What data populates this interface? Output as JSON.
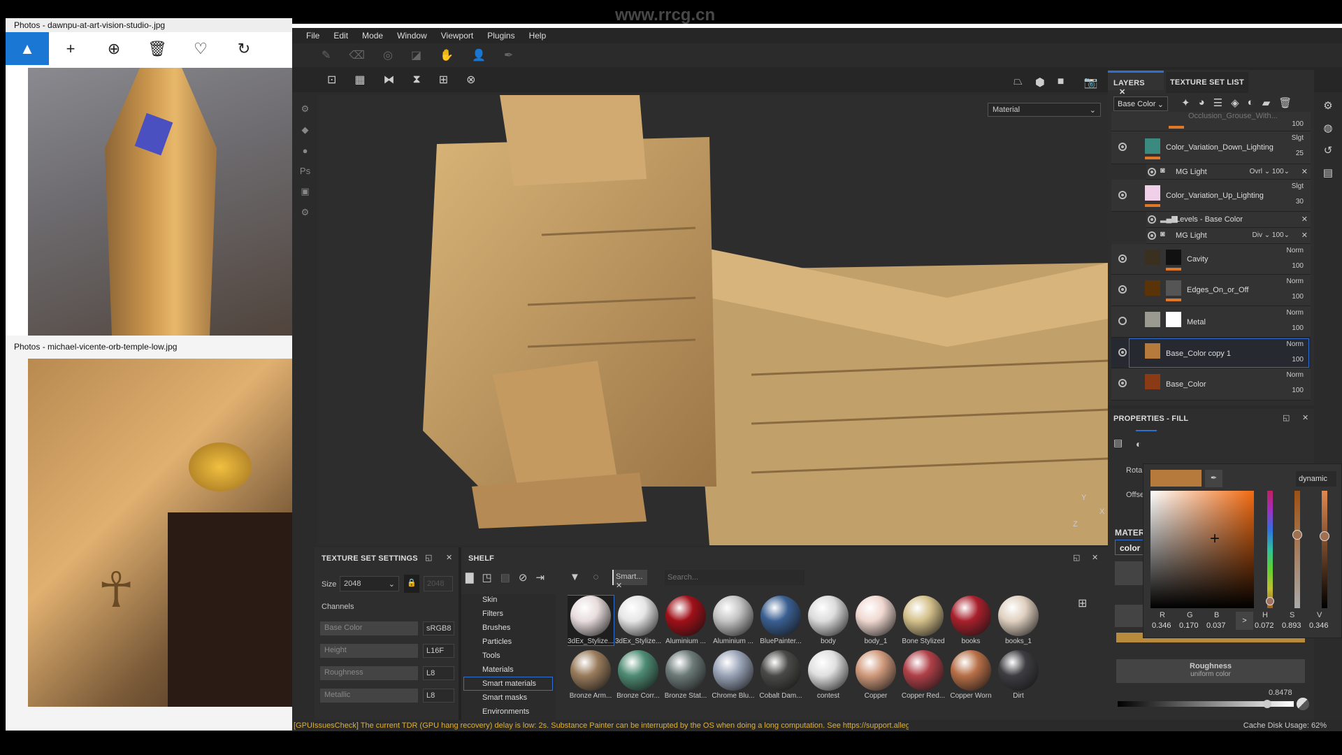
{
  "watermark": "www.rrcg.cn",
  "photos1": {
    "title": "Photos - dawnpu-at-art-vision-studio-.jpg",
    "tools": [
      "image-icon",
      "plus-icon",
      "zoom-in-icon",
      "trash-icon",
      "heart-icon",
      "rotate-icon",
      "edit-icon"
    ]
  },
  "photos2": {
    "title": "Photos - michael-vicente-orb-temple-low.jpg"
  },
  "menu": [
    "File",
    "Edit",
    "Mode",
    "Window",
    "Viewport",
    "Plugins",
    "Help"
  ],
  "viewport": {
    "mode_select": "Material",
    "axis": {
      "x": "X",
      "y": "Y",
      "z": "Z"
    }
  },
  "layers": {
    "tabs": [
      "LAYERS",
      "TEXTURE SET LIST"
    ],
    "channel": "Base Color",
    "items": [
      {
        "name": "Occlusion_Grouse_With...",
        "blend": "",
        "opacity": "100",
        "visible": true
      },
      {
        "name": "Color_Variation_Down_Lighting",
        "blend": "Slgt",
        "opacity": "25",
        "visible": true
      },
      {
        "name": "MG Light",
        "blend": "Ovrl",
        "opacity": "100",
        "sub": true
      },
      {
        "name": "Color_Variation_Up_Lighting",
        "blend": "Slgt",
        "opacity": "30",
        "visible": true
      },
      {
        "name": "Levels - Base Color",
        "blend": "",
        "opacity": "",
        "sub": true
      },
      {
        "name": "MG Light",
        "blend": "Div",
        "opacity": "100",
        "sub": true
      },
      {
        "name": "Cavity",
        "blend": "Norm",
        "opacity": "100",
        "visible": true
      },
      {
        "name": "Edges_On_or_Off",
        "blend": "Norm",
        "opacity": "100",
        "visible": true
      },
      {
        "name": "Metal",
        "blend": "Norm",
        "opacity": "100",
        "visible": false
      },
      {
        "name": "Base_Color copy 1",
        "blend": "Norm",
        "opacity": "100",
        "visible": true,
        "selected": true
      },
      {
        "name": "Base_Color",
        "blend": "Norm",
        "opacity": "100",
        "visible": true
      }
    ]
  },
  "properties": {
    "title": "PROPERTIES - FILL",
    "rotation_label": "Rota",
    "offset_label": "Offse",
    "material_label": "MATER",
    "color_tab": "color",
    "roughness": {
      "title": "Roughness",
      "subtitle": "uniform color",
      "value": "0.8478",
      "fraction": 0.8478
    }
  },
  "color_picker": {
    "mode": "dynamic",
    "swatch": "#b57a3c",
    "labels": {
      "r": "R",
      "g": "G",
      "b": "B",
      "h": "H",
      "s": "S",
      "v": "V"
    },
    "values": {
      "r": "0.346",
      "g": "0.170",
      "b": "0.037",
      "h": "0.072",
      "s": "0.893",
      "v": "0.346"
    },
    "toggle": ">"
  },
  "texture_set": {
    "title": "TEXTURE SET SETTINGS",
    "size_label": "Size",
    "size": "2048",
    "size_locked": "2048",
    "channels_label": "Channels",
    "channels": [
      {
        "name": "Base Color",
        "format": "sRGB8"
      },
      {
        "name": "Height",
        "format": "L16F"
      },
      {
        "name": "Roughness",
        "format": "L8"
      },
      {
        "name": "Metallic",
        "format": "L8"
      }
    ]
  },
  "shelf": {
    "title": "SHELF",
    "filter_chip": "Smart...",
    "search_placeholder": "Search...",
    "categories": [
      "Skin",
      "Filters",
      "Brushes",
      "Particles",
      "Tools",
      "Materials",
      "Smart materials",
      "Smart masks",
      "Environments"
    ],
    "selected_category": "Smart materials",
    "materials": [
      {
        "name": "3dEx_Stylize...",
        "color": "#e8dcdc"
      },
      {
        "name": "3dEx_Stylize...",
        "color": "#e6e6e6"
      },
      {
        "name": "Aluminium ...",
        "color": "#a01018"
      },
      {
        "name": "Aluminium ...",
        "color": "#c4c4c4"
      },
      {
        "name": "BluePainter...",
        "color": "#3a5f92"
      },
      {
        "name": "body",
        "color": "#dcdcdc"
      },
      {
        "name": "body_1",
        "color": "#f0d8d0"
      },
      {
        "name": "Bone Stylized",
        "color": "#d4c08a"
      },
      {
        "name": "books",
        "color": "#a8202c"
      },
      {
        "name": "books_1",
        "color": "#e0d0c0"
      },
      {
        "name": "Bronze Arm...",
        "color": "#9a7c5c"
      },
      {
        "name": "Bronze Corr...",
        "color": "#4e8c74"
      },
      {
        "name": "Bronze Stat...",
        "color": "#6c7a78"
      },
      {
        "name": "Chrome Blu...",
        "color": "#9aa4b8"
      },
      {
        "name": "Cobalt Dam...",
        "color": "#4a4a48"
      },
      {
        "name": "contest",
        "color": "#e0e0e0"
      },
      {
        "name": "Copper",
        "color": "#d09a7c"
      },
      {
        "name": "Copper Red...",
        "color": "#b04048"
      },
      {
        "name": "Copper Worn",
        "color": "#b87048"
      },
      {
        "name": "Dirt",
        "color": "#3e3e42"
      }
    ]
  },
  "status": {
    "message": "[GPUIssuesCheck] The current TDR (GPU hang recovery) delay is low: 2s. Substance Painter can be interrupted by the OS when doing a long computation. See https://support.alleg...",
    "cache": "Cache Disk Usage:",
    "cache_value": "62%"
  },
  "colors": {
    "accent": "#e0782a",
    "selection": "#2f6fd0",
    "warning": "#e0b030"
  }
}
